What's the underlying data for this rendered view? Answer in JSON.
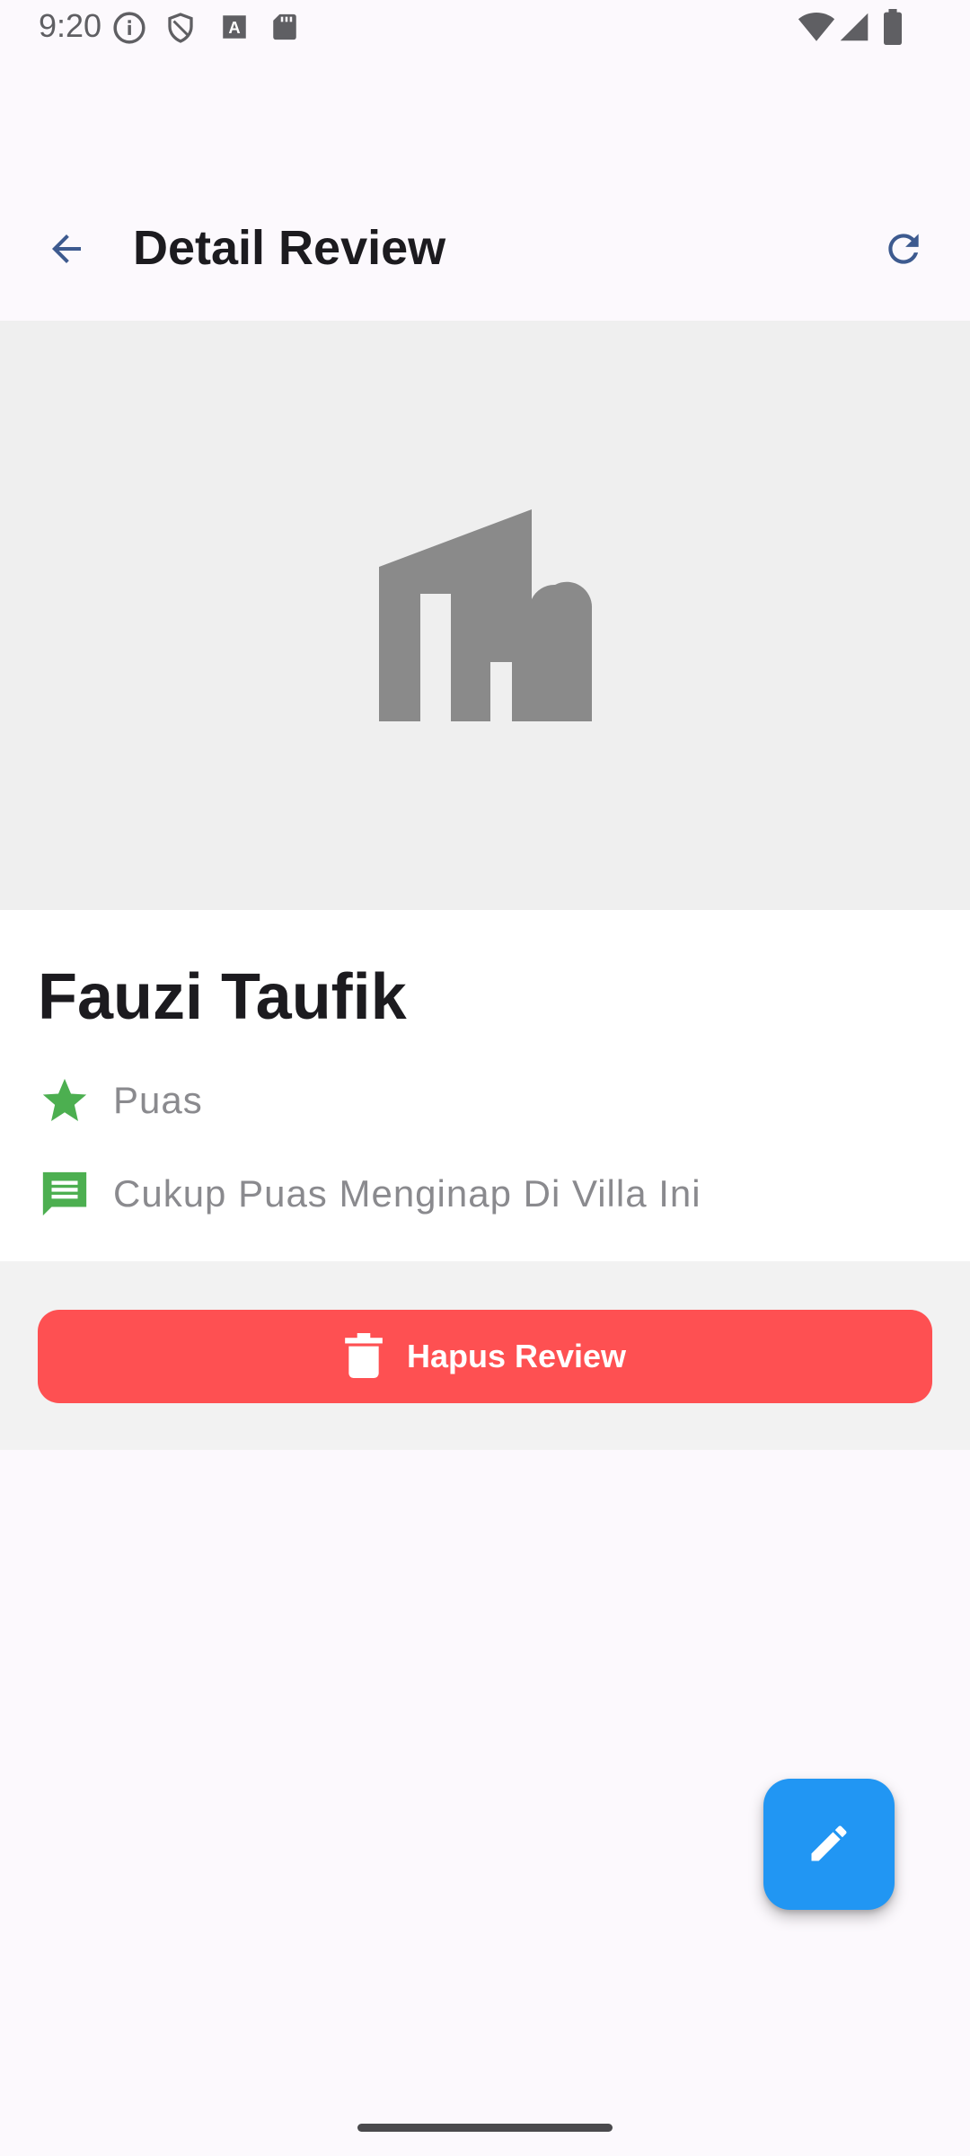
{
  "status_bar": {
    "time": "9:20",
    "left_icons": [
      "info-icon",
      "shield-icon",
      "font-a-icon",
      "sd-card-icon"
    ],
    "right_icons": [
      "wifi-icon",
      "signal-icon",
      "battery-icon"
    ]
  },
  "app_bar": {
    "title": "Detail Review",
    "back_icon": "arrow-back-icon",
    "refresh_icon": "refresh-icon"
  },
  "hero": {
    "placeholder_icon": "house-placeholder-icon"
  },
  "review": {
    "name": "Fauzi Taufik",
    "rating_text": "Puas",
    "comment_text": "Cukup Puas Menginap Di Villa Ini"
  },
  "actions": {
    "delete_label": "Hapus Review",
    "edit_icon": "edit-pencil-icon"
  },
  "colors": {
    "accent_blue": "#2196f3",
    "danger_red": "#fe5052",
    "star_green": "#4caf50",
    "icon_gray": "#8a8a8a"
  }
}
